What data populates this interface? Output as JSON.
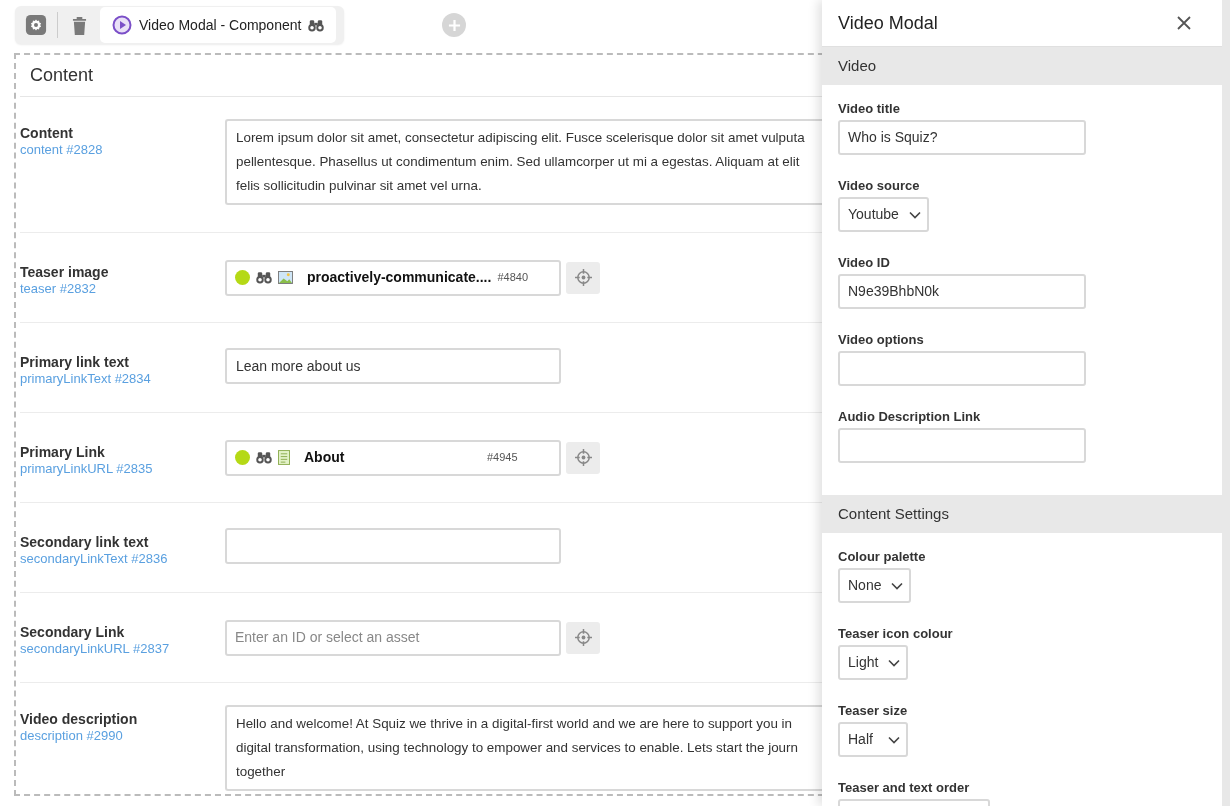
{
  "toolbar": {
    "tab": {
      "label": "Video Modal - Component",
      "selected": true
    }
  },
  "content": {
    "title": "Content",
    "rows": [
      {
        "label": "Content",
        "field": "content #2828",
        "kind": "textarea",
        "lines": [
          "Lorem ipsum dolor sit amet, consectetur adipiscing elit. Fusce scelerisque dolor sit amet vulputa",
          "pellentesque. Phasellus ut condimentum enim. Sed ullamcorper ut mi a egestas. Aliquam at elit",
          "felis sollicitudin pulvinar sit amet vel urna."
        ]
      },
      {
        "label": "Teaser image",
        "field": "teaser #2832",
        "kind": "asset",
        "asset": {
          "kind": "image",
          "name": "proactively-communicate....",
          "id": "#4840"
        }
      },
      {
        "label": "Primary link text",
        "field": "primaryLinkText #2834",
        "kind": "text",
        "value": "Lean more about us"
      },
      {
        "label": "Primary Link",
        "field": "primaryLinkURL #2835",
        "kind": "asset",
        "asset": {
          "kind": "page",
          "name": "About",
          "id": "#4945"
        }
      },
      {
        "label": "Secondary link text",
        "field": "secondaryLinkText #2836",
        "kind": "text"
      },
      {
        "label": "Secondary Link",
        "field": "secondaryLinkURL #2837",
        "kind": "asset",
        "placeholder": "Enter an ID or select an asset"
      },
      {
        "label": "Video description",
        "field": "description #2990",
        "kind": "textarea",
        "lines": [
          "Hello and welcome! At Squiz we thrive in a digital-first world and we are here to support you in",
          "digital transformation, using technology to empower and services to enable. Lets start the journ",
          "together"
        ]
      }
    ]
  },
  "panel": {
    "title": "Video Modal",
    "sections": [
      {
        "title": "Video",
        "fields": [
          {
            "label": "Video title",
            "kind": "text",
            "value": "Who is Squiz?"
          },
          {
            "label": "Video source",
            "kind": "select",
            "value": "Youtube"
          },
          {
            "label": "Video ID",
            "kind": "text",
            "value": "N9e39BhbN0k"
          },
          {
            "label": "Video options",
            "kind": "text"
          },
          {
            "label": "Audio Description Link",
            "kind": "text"
          }
        ]
      },
      {
        "title": "Content Settings",
        "fields": [
          {
            "label": "Colour palette",
            "kind": "select",
            "value": "None"
          },
          {
            "label": "Teaser icon colour",
            "kind": "select",
            "value": "Light"
          },
          {
            "label": "Teaser size",
            "kind": "select",
            "value": "Half"
          },
          {
            "label": "Teaser and text order",
            "kind": "select"
          }
        ]
      }
    ]
  }
}
